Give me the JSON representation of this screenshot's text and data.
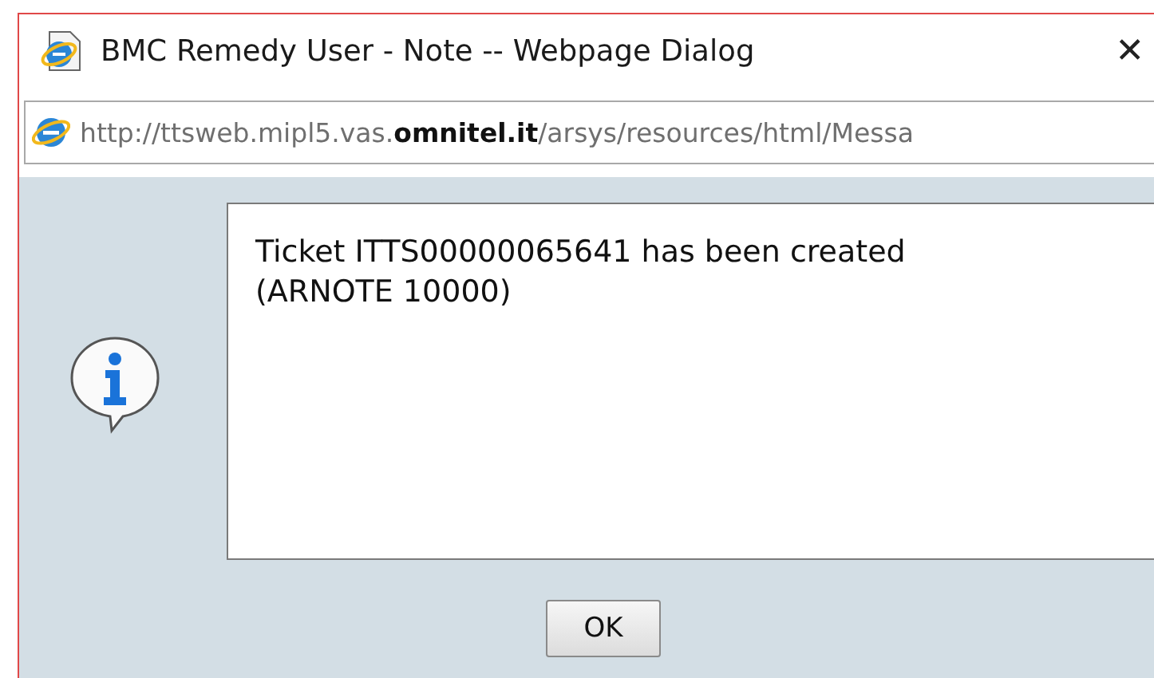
{
  "window": {
    "title": "BMC Remedy User - Note -- Webpage Dialog",
    "close": "✕"
  },
  "address_bar": {
    "url": "http://ttsweb.mipl5.vas.**omnitel.it**/arsys/resources/html/Messa"
  },
  "message": {
    "text": "Ticket ITTS00000065641 has been created (ARNOTE 10000)"
  },
  "buttons": [
    "OK"
  ]
}
